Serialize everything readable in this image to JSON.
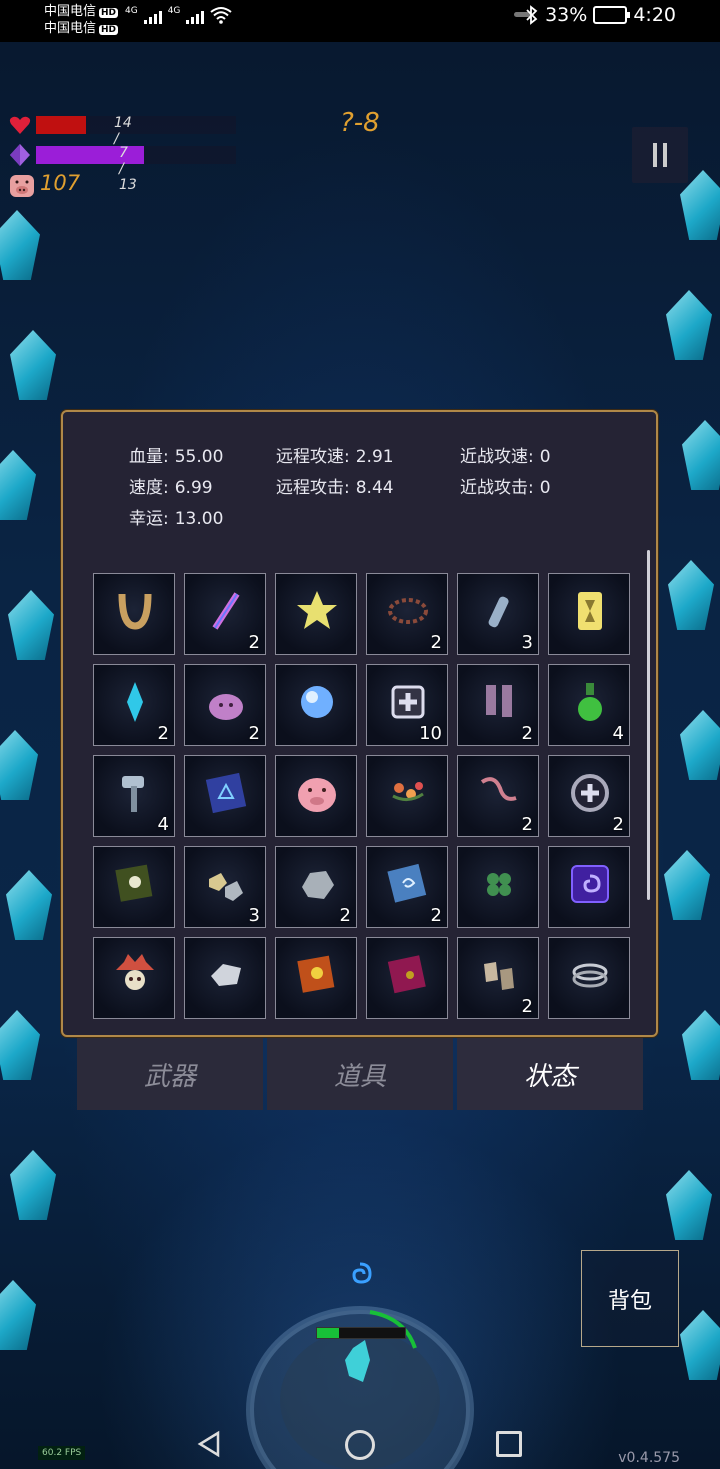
{
  "status_bar": {
    "carrier1": "中国电信",
    "carrier2": "中国电信",
    "hd": "HD",
    "net1": "4G",
    "net2": "4G",
    "battery": "33%",
    "time": "4:20"
  },
  "hud": {
    "hp": "14 / 55",
    "mp": "7 / 13",
    "coins": "107",
    "level": "?-8",
    "hp_fraction": 0.25,
    "mp_fraction": 0.54
  },
  "stats": {
    "hp_label": "血量:",
    "hp_value": "55.00",
    "speed_label": "速度:",
    "speed_value": "6.99",
    "luck_label": "幸运:",
    "luck_value": "13.00",
    "ranged_speed_label": "远程攻速:",
    "ranged_speed_value": "2.91",
    "ranged_attack_label": "远程攻击:",
    "ranged_attack_value": "8.44",
    "melee_speed_label": "近战攻速:",
    "melee_speed_value": "0",
    "melee_attack_label": "近战攻击:",
    "melee_attack_value": "0"
  },
  "items": [
    {
      "icon": "horseshoe-icon",
      "count": ""
    },
    {
      "icon": "wand-icon",
      "count": "2"
    },
    {
      "icon": "star-icon",
      "count": ""
    },
    {
      "icon": "thorn-crown-icon",
      "count": "2"
    },
    {
      "icon": "bottle-icon",
      "count": "3"
    },
    {
      "icon": "hourglass-card-icon",
      "count": ""
    },
    {
      "icon": "crystal-icon",
      "count": "2"
    },
    {
      "icon": "slime-icon",
      "count": "2"
    },
    {
      "icon": "orb-icon",
      "count": ""
    },
    {
      "icon": "medkit-icon",
      "count": "10"
    },
    {
      "icon": "boots-icon",
      "count": "2"
    },
    {
      "icon": "potion-icon",
      "count": "4"
    },
    {
      "icon": "hammer-icon",
      "count": "4"
    },
    {
      "icon": "spellbook-icon",
      "count": ""
    },
    {
      "icon": "piggy-bank-icon",
      "count": ""
    },
    {
      "icon": "flower-wreath-icon",
      "count": ""
    },
    {
      "icon": "worm-icon",
      "count": "2"
    },
    {
      "icon": "health-ring-icon",
      "count": "2"
    },
    {
      "icon": "skull-book-icon",
      "count": ""
    },
    {
      "icon": "ore-icon",
      "count": "3"
    },
    {
      "icon": "stone-icon",
      "count": "2"
    },
    {
      "icon": "swirl-book-icon",
      "count": "2"
    },
    {
      "icon": "clover-icon",
      "count": ""
    },
    {
      "icon": "vortex-cube-icon",
      "count": ""
    },
    {
      "icon": "spiky-skull-icon",
      "count": ""
    },
    {
      "icon": "silver-stone-icon",
      "count": ""
    },
    {
      "icon": "gold-book-icon",
      "count": ""
    },
    {
      "icon": "red-book-icon",
      "count": ""
    },
    {
      "icon": "rock-boots-icon",
      "count": "2"
    },
    {
      "icon": "double-ring-icon",
      "count": ""
    }
  ],
  "tabs": {
    "weapons": "武器",
    "items": "道具",
    "status": "状态"
  },
  "backpack_label": "背包",
  "fps": "60.2 FPS",
  "version": "v0.4.575"
}
